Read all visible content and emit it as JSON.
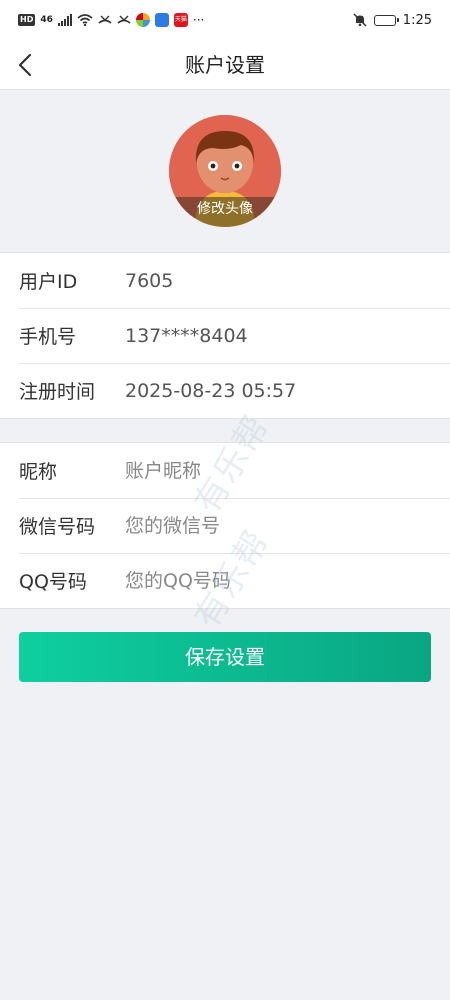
{
  "status_bar": {
    "hd_badge": "HD",
    "network": "46",
    "time": "1:25",
    "more_dots": "···",
    "tmall_badge": "天猫",
    "icons": [
      "hd-icon",
      "signal-icon",
      "wifi-icon",
      "missed-call-icon",
      "missed-call-icon",
      "app-icon",
      "app-icon",
      "tmall-icon",
      "mute-bell-icon",
      "battery-icon"
    ]
  },
  "header": {
    "title": "账户设置",
    "back_icon": "chevron-left-icon"
  },
  "avatar": {
    "label": "修改头像"
  },
  "account_info": {
    "rows": [
      {
        "label": "用户ID",
        "value": "7605"
      },
      {
        "label": "手机号",
        "value": "137****8404"
      },
      {
        "label": "注册时间",
        "value": "2025-08-23 05:57"
      }
    ]
  },
  "profile_form": {
    "nickname": {
      "label": "昵称",
      "placeholder": "账户昵称",
      "value": ""
    },
    "wechat": {
      "label": "微信号码",
      "placeholder": "您的微信号",
      "value": ""
    },
    "qq": {
      "label": "QQ号码",
      "placeholder": "您的QQ号码",
      "value": ""
    }
  },
  "save_button": {
    "label": "保存设置"
  },
  "watermark": {
    "text": "有乐帮"
  },
  "colors": {
    "accent_start": "#0ecf9f",
    "accent_end": "#0aa682",
    "avatar_bg": "#e06450",
    "page_bg": "#f0f1f4"
  }
}
